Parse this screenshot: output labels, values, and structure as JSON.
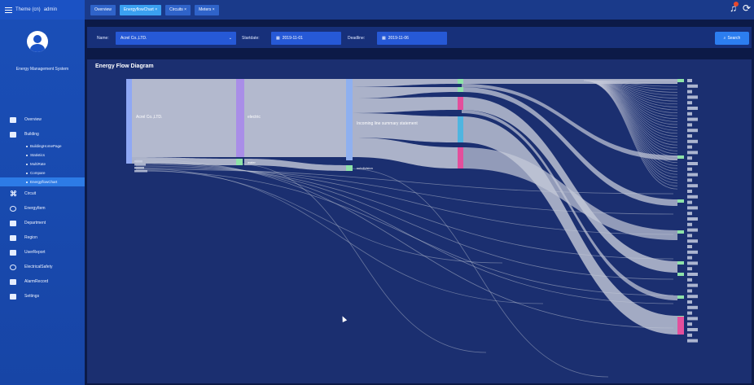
{
  "header": {
    "theme_label": "Theme (cn)",
    "user_label": "admin",
    "tabs": [
      {
        "label": "Overview",
        "active": false
      },
      {
        "label": "EnergyflowChart",
        "active": true
      },
      {
        "label": "Circuits",
        "active": false
      },
      {
        "label": "Meters",
        "active": false
      }
    ],
    "notification_icon": "bell-icon",
    "refresh_icon": "refresh-icon"
  },
  "sidebar": {
    "system_name": "Energy Management System",
    "items": [
      {
        "label": "Overview",
        "icon": "monitor-icon"
      },
      {
        "label": "Building",
        "icon": "building-icon"
      },
      {
        "label": "Circuit",
        "icon": "circuit-icon"
      },
      {
        "label": "EnergyItem",
        "icon": "energy-icon"
      },
      {
        "label": "Department",
        "icon": "department-icon"
      },
      {
        "label": "Region",
        "icon": "region-icon"
      },
      {
        "label": "UserReport",
        "icon": "report-icon"
      },
      {
        "label": "ElectricalSafety",
        "icon": "safety-icon"
      },
      {
        "label": "AlarmRecord",
        "icon": "alarm-icon"
      },
      {
        "label": "Settings",
        "icon": "settings-icon"
      }
    ],
    "building_sub": [
      {
        "label": "BuildingHomePage",
        "active": false
      },
      {
        "label": "Statistics",
        "active": false
      },
      {
        "label": "MultiRate",
        "active": false
      },
      {
        "label": "Compare",
        "active": false
      },
      {
        "label": "EnergyflowChart",
        "active": true
      }
    ]
  },
  "filters": {
    "name_label": "Name:",
    "name_value": "Acrel Co.,LTD.",
    "start_label": "Startdate:",
    "start_value": "2019-11-01",
    "end_label": "Deadline:",
    "end_value": "2019-11-06",
    "search_label": "Search"
  },
  "panel": {
    "title": "Energy Flow Diagram"
  },
  "chart_data": {
    "type": "sankey",
    "title": "Energy Flow Diagram",
    "nodes": [
      {
        "name": "Acrel Co.,LTD.",
        "color": "#8fa8f5"
      },
      {
        "name": "electric",
        "color": "#a98ee8"
      },
      {
        "name": "Incoming line summary statement",
        "color": "#8fb0f0"
      },
      {
        "name": "water",
        "color": "#9de0a8"
      },
      {
        "name": "subdivision",
        "color": "#9de0a8"
      }
    ],
    "colors": {
      "link": "#c4c9d8",
      "accent": "#3aa0f0",
      "node_green": "#8ee2a9",
      "node_pink": "#e34f9c",
      "node_cyan": "#4fb5e0"
    }
  }
}
